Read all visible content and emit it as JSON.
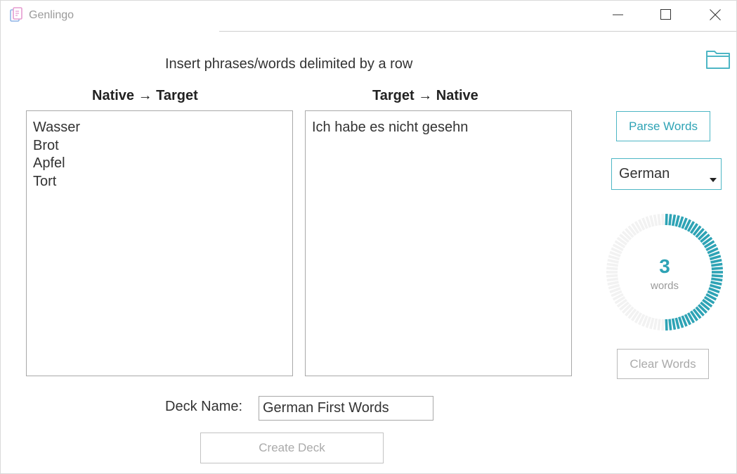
{
  "window": {
    "title": "Genlingo"
  },
  "header": {
    "instruction": "Insert phrases/words delimited by a row"
  },
  "columns": {
    "native_to_target": {
      "title": "Native → Target",
      "lines": [
        "Wasser",
        "Brot",
        "Apfel",
        "Tort"
      ]
    },
    "target_to_native": {
      "title": "Target → Native",
      "lines": [
        "Ich habe es nicht gesehn"
      ]
    }
  },
  "sidebar": {
    "parse_button": "Parse Words",
    "language_select": {
      "value": "German"
    },
    "progress": {
      "count": "3",
      "unit": "words",
      "fraction": 0.5,
      "color": "#2ea3b5"
    },
    "clear_button": "Clear Words"
  },
  "deck": {
    "label": "Deck Name:",
    "name_value": "German First Words",
    "create_button": "Create Deck"
  },
  "icons": {
    "app": "genlingo-app-icon",
    "folder": "folder-icon",
    "minimize": "minimize-icon",
    "maximize": "maximize-icon",
    "close": "close-icon"
  }
}
